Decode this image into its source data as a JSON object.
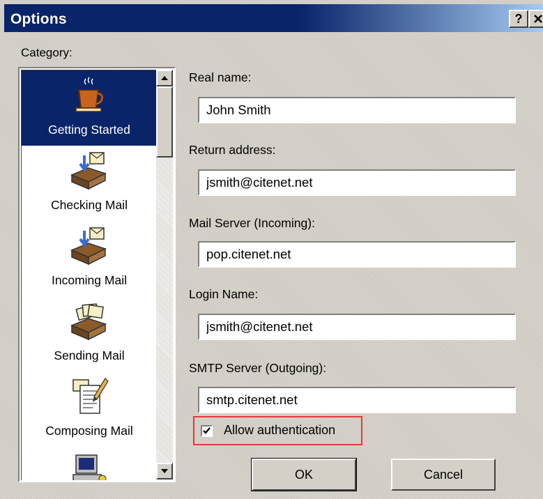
{
  "window": {
    "title": "Options",
    "help_label": "?",
    "close_label": "✕"
  },
  "category_label": "Category:",
  "categories": [
    {
      "label": "Getting Started",
      "icon": "coffee-cup-icon",
      "selected": true
    },
    {
      "label": "Checking Mail",
      "icon": "mail-tray-check-icon",
      "selected": false
    },
    {
      "label": "Incoming Mail",
      "icon": "mail-tray-incoming-icon",
      "selected": false
    },
    {
      "label": "Sending Mail",
      "icon": "mail-tray-outgoing-icon",
      "selected": false
    },
    {
      "label": "Composing Mail",
      "icon": "compose-notepad-icon",
      "selected": false
    },
    {
      "label": "",
      "icon": "computer-icon",
      "selected": false
    }
  ],
  "fields": {
    "real_name": {
      "label": "Real name:",
      "value": "John Smith"
    },
    "return_address": {
      "label": "Return address:",
      "value": "jsmith@citenet.net"
    },
    "mail_server": {
      "label": "Mail Server (Incoming):",
      "value": "pop.citenet.net"
    },
    "login_name": {
      "label": "Login Name:",
      "value": "jsmith@citenet.net"
    },
    "smtp_server": {
      "label": "SMTP Server (Outgoing):",
      "value": "smtp.citenet.net"
    }
  },
  "allow_auth": {
    "label": "Allow authentication",
    "checked": true
  },
  "buttons": {
    "ok": "OK",
    "cancel": "Cancel"
  },
  "colors": {
    "titlebar": "#0a246a",
    "selection": "#0a246a",
    "highlight_box": "#e23a3a"
  }
}
